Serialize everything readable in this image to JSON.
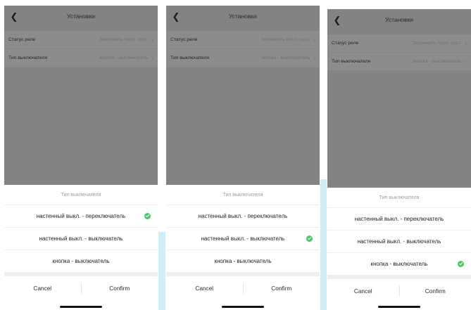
{
  "screens": [
    {
      "header": {
        "title": "Установки"
      },
      "settings": [
        {
          "label": "Статус реле",
          "value": "Запомнить посл. сост."
        },
        {
          "label": "Тип выключателя",
          "value": "кнопка - выключатель"
        }
      ],
      "sheet": {
        "title": "Тип выключателя",
        "options": [
          {
            "label": "настенный выкл. - переключатель",
            "selected": true
          },
          {
            "label": "настенный выкл. - выключатель",
            "selected": false
          },
          {
            "label": "кнопка - выключатель",
            "selected": false
          }
        ],
        "cancel_label": "Cancel",
        "confirm_label": "Confirm"
      }
    },
    {
      "header": {
        "title": "Установки"
      },
      "settings": [
        {
          "label": "Статус реле",
          "value": "Запомнить посл. сост."
        },
        {
          "label": "Тип выключателя",
          "value": "кнопка - выключатель"
        }
      ],
      "sheet": {
        "title": "Тип выключателя",
        "options": [
          {
            "label": "настенный выкл. - переключатель",
            "selected": false
          },
          {
            "label": "настенный выкл. - выключатель",
            "selected": true
          },
          {
            "label": "кнопка - выключатель",
            "selected": false
          }
        ],
        "cancel_label": "Cancel",
        "confirm_label": "Confirm"
      }
    },
    {
      "header": {
        "title": "Установки"
      },
      "settings": [
        {
          "label": "Статус реле",
          "value": "Запомнить посл. сост."
        },
        {
          "label": "Тип выключателя",
          "value": "кнопка - выключатель"
        }
      ],
      "sheet": {
        "title": "Тип выключателя",
        "options": [
          {
            "label": "настенный выкл. - переключатель",
            "selected": false
          },
          {
            "label": "настенный выкл. - выключатель",
            "selected": false
          },
          {
            "label": "кнопка - выключатель",
            "selected": true
          }
        ],
        "cancel_label": "Cancel",
        "confirm_label": "Confirm"
      }
    }
  ],
  "colors": {
    "overlay": "#838383",
    "check": "#4cc46a",
    "accent_stripe": "#cfeef6"
  },
  "icons": {
    "back": "chevron-left-icon",
    "chevron": "chevron-right-icon",
    "check": "check-circle-icon"
  }
}
